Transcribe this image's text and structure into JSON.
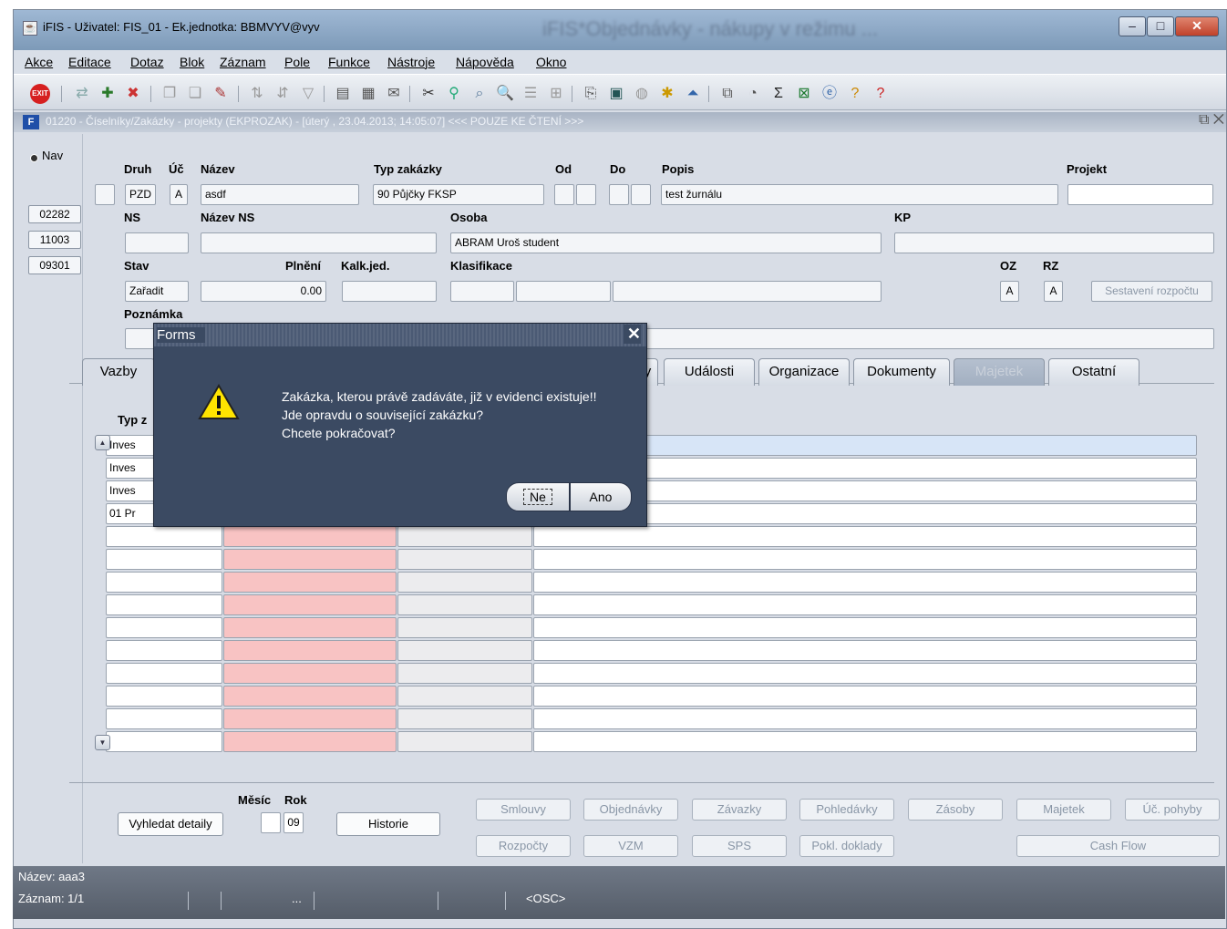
{
  "window": {
    "title": "iFIS - Uživatel: FIS_01 - Ek.jednotka: BBMVYV@vyv",
    "blurred_title": "iFIS*Objednávky - nákupy v režimu ..."
  },
  "menu": [
    "Akce",
    "Editace",
    "Dotaz",
    "Blok",
    "Záznam",
    "Pole",
    "Funkce",
    "Nástroje",
    "Nápověda",
    "Okno"
  ],
  "form_header": "01220 - Číselníky/Zakázky - projekty (EKPROZAK) - [úterý , 23.04.2013; 14:05:07] <<< POUZE KE ČTENÍ >>>",
  "nav": {
    "label": "Nav",
    "items": [
      "02282",
      "11003",
      "09301"
    ]
  },
  "fields": {
    "druh_label": "Druh",
    "druh": "PZD",
    "uc_label": "Úč",
    "uc": "A",
    "nazev_label": "Název",
    "nazev": "asdf",
    "typ_label": "Typ zakázky",
    "typ": "90 Půjčky FKSP",
    "od_label": "Od",
    "do_label": "Do",
    "popis_label": "Popis",
    "popis": "test žurnálu",
    "projekt_label": "Projekt",
    "ns_label": "NS",
    "nazev_ns_label": "Název NS",
    "osoba_label": "Osoba",
    "osoba": "ABRAM Uroš  student",
    "kp_label": "KP",
    "stav_label": "Stav",
    "stav": "Zařadit",
    "plneni_label": "Plnění",
    "plneni": "0.00",
    "kalk_label": "Kalk.jed.",
    "klas_label": "Klasifikace",
    "oz_label": "OZ",
    "oz": "A",
    "rz_label": "RZ",
    "rz": "A",
    "sestaveni": "Sestavení rozpočtu",
    "poznamka_label": "Poznámka"
  },
  "tabs": {
    "vazby": "Vazby",
    "hidden_suffix": "y",
    "udalosti": "Události",
    "organizace": "Organizace",
    "dokumenty": "Dokumenty",
    "majetek": "Majetek",
    "ostatni": "Ostatní"
  },
  "grid": {
    "col1_label": "Typ z",
    "rows": [
      "Inves",
      "Inves",
      "Inves",
      "01 Pr"
    ]
  },
  "bottom": {
    "vyhledat": "Vyhledat detaily",
    "mesic_label": "Měsíc",
    "rok_label": "Rok",
    "mesic": "",
    "rok": "09",
    "historie": "Historie",
    "smlouvy": "Smlouvy",
    "objednavky": "Objednávky",
    "zavazky": "Závazky",
    "pohledavky": "Pohledávky",
    "zasoby": "Zásoby",
    "majetek": "Majetek",
    "uc_pohyby": "Úč. pohyby",
    "rozpocty": "Rozpočty",
    "vzm": "VZM",
    "sps": "SPS",
    "pokl": "Pokl. doklady",
    "cashflow": "Cash Flow"
  },
  "status": {
    "nazev": "Název: aaa3",
    "zaznam": "Záznam: 1/1",
    "dots": "...",
    "osc": "<OSC>"
  },
  "dialog": {
    "title": "Forms",
    "line1": "Zakázka, kterou právě zadáváte, již v evidenci existuje!!",
    "line2": "Jde opravdu o související zakázku?",
    "line3": "Chcete pokračovat?",
    "no": "Ne",
    "yes": "Ano"
  },
  "colors": {
    "dialog_bg": "#3b4a62",
    "pink_column": "#f8c3c3",
    "selected_row": "#d7e5f7"
  }
}
